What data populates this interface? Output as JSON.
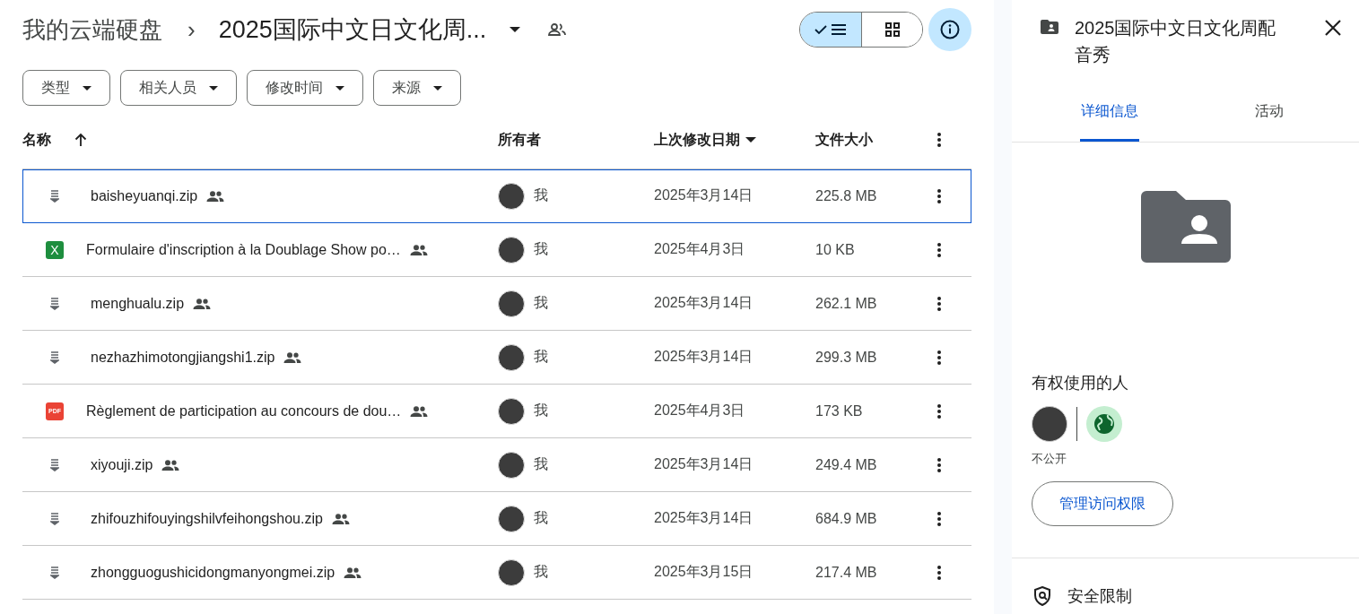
{
  "breadcrumb": {
    "root": "我的云端硬盘",
    "separator": "›",
    "current": "2025国际中文日文化周..."
  },
  "view_toggle": [
    {
      "kind": "list",
      "selected": true
    },
    {
      "kind": "grid",
      "selected": false
    }
  ],
  "info_button": {
    "selected": true
  },
  "filters": [
    "类型",
    "相关人员",
    "修改时间",
    "来源"
  ],
  "table": {
    "columns": [
      {
        "label": "名称",
        "kind": "ascending"
      },
      {
        "label": "所有者",
        "kind": "plain"
      },
      {
        "label": "上次修改日期",
        "kind": "descending"
      },
      {
        "label": "文件大小",
        "kind": "plain"
      }
    ],
    "rows": [
      {
        "kind": "zip",
        "name": "baisheyuanqi.zip",
        "shared": true,
        "owner": "我",
        "modified": "2025年3月14日",
        "size": "225.8 MB",
        "selected": true
      },
      {
        "kind": "sheet",
        "icon_label": "X",
        "name": "Formulaire d'inscription à la Doublage Show po…",
        "shared": true,
        "owner": "我",
        "modified": "2025年4月3日",
        "size": "10 KB",
        "selected": false
      },
      {
        "kind": "zip",
        "name": "menghualu.zip",
        "shared": true,
        "owner": "我",
        "modified": "2025年3月14日",
        "size": "262.1 MB",
        "selected": false
      },
      {
        "kind": "zip",
        "name": "nezhazhimotongjiangshi1.zip",
        "shared": true,
        "owner": "我",
        "modified": "2025年3月14日",
        "size": "299.3 MB",
        "selected": false
      },
      {
        "kind": "pdf",
        "icon_label": "PDF",
        "name": "Règlement de participation au concours de dou…",
        "shared": true,
        "owner": "我",
        "modified": "2025年4月3日",
        "size": "173 KB",
        "selected": false
      },
      {
        "kind": "zip",
        "name": "xiyouji.zip",
        "shared": true,
        "owner": "我",
        "modified": "2025年3月14日",
        "size": "249.4 MB",
        "selected": false
      },
      {
        "kind": "zip",
        "name": "zhifouzhifouyingshilvfeihongshou.zip",
        "shared": true,
        "owner": "我",
        "modified": "2025年3月14日",
        "size": "684.9 MB",
        "selected": false
      },
      {
        "kind": "zip",
        "name": "zhongguogushicidongmanyongmei.zip",
        "shared": true,
        "owner": "我",
        "modified": "2025年3月15日",
        "size": "217.4 MB",
        "selected": false
      }
    ]
  },
  "details_panel": {
    "title": "2025国际中文日文化周配音秀",
    "tabs": [
      {
        "label": "详细信息",
        "selected": true
      },
      {
        "label": "活动",
        "selected": false
      }
    ],
    "access_heading": "有权使用的人",
    "access_status": "不公开",
    "manage_button": "管理访问权限",
    "security_heading": "安全限制"
  }
}
